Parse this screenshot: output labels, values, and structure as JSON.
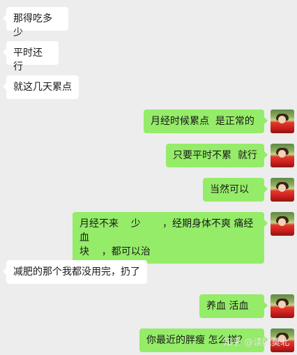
{
  "chat": {
    "messages": [
      {
        "side": "left",
        "text": "那得吃多少"
      },
      {
        "side": "left",
        "text": "平时还行"
      },
      {
        "side": "left",
        "text": "就这几天累点"
      },
      {
        "side": "right",
        "text": "月经时候累点  是正常的"
      },
      {
        "side": "right",
        "text": "只要平时不累  就行"
      },
      {
        "side": "right",
        "text": "当然可以"
      },
      {
        "side": "right",
        "text": "月经不来    少       ，经期身体不爽 痛经血\n块    ，都可以治"
      },
      {
        "side": "left",
        "text": "减肥的那个我都没用完，扔了"
      },
      {
        "side": "right",
        "text": "养血 活血"
      },
      {
        "side": "right",
        "text": "你最近的胖瘦 怎么样？"
      }
    ]
  },
  "watermark": "知乎 @读阮莫北",
  "colors": {
    "background": "#ededed",
    "incoming_bubble": "#ffffff",
    "outgoing_bubble": "#95ec69"
  }
}
